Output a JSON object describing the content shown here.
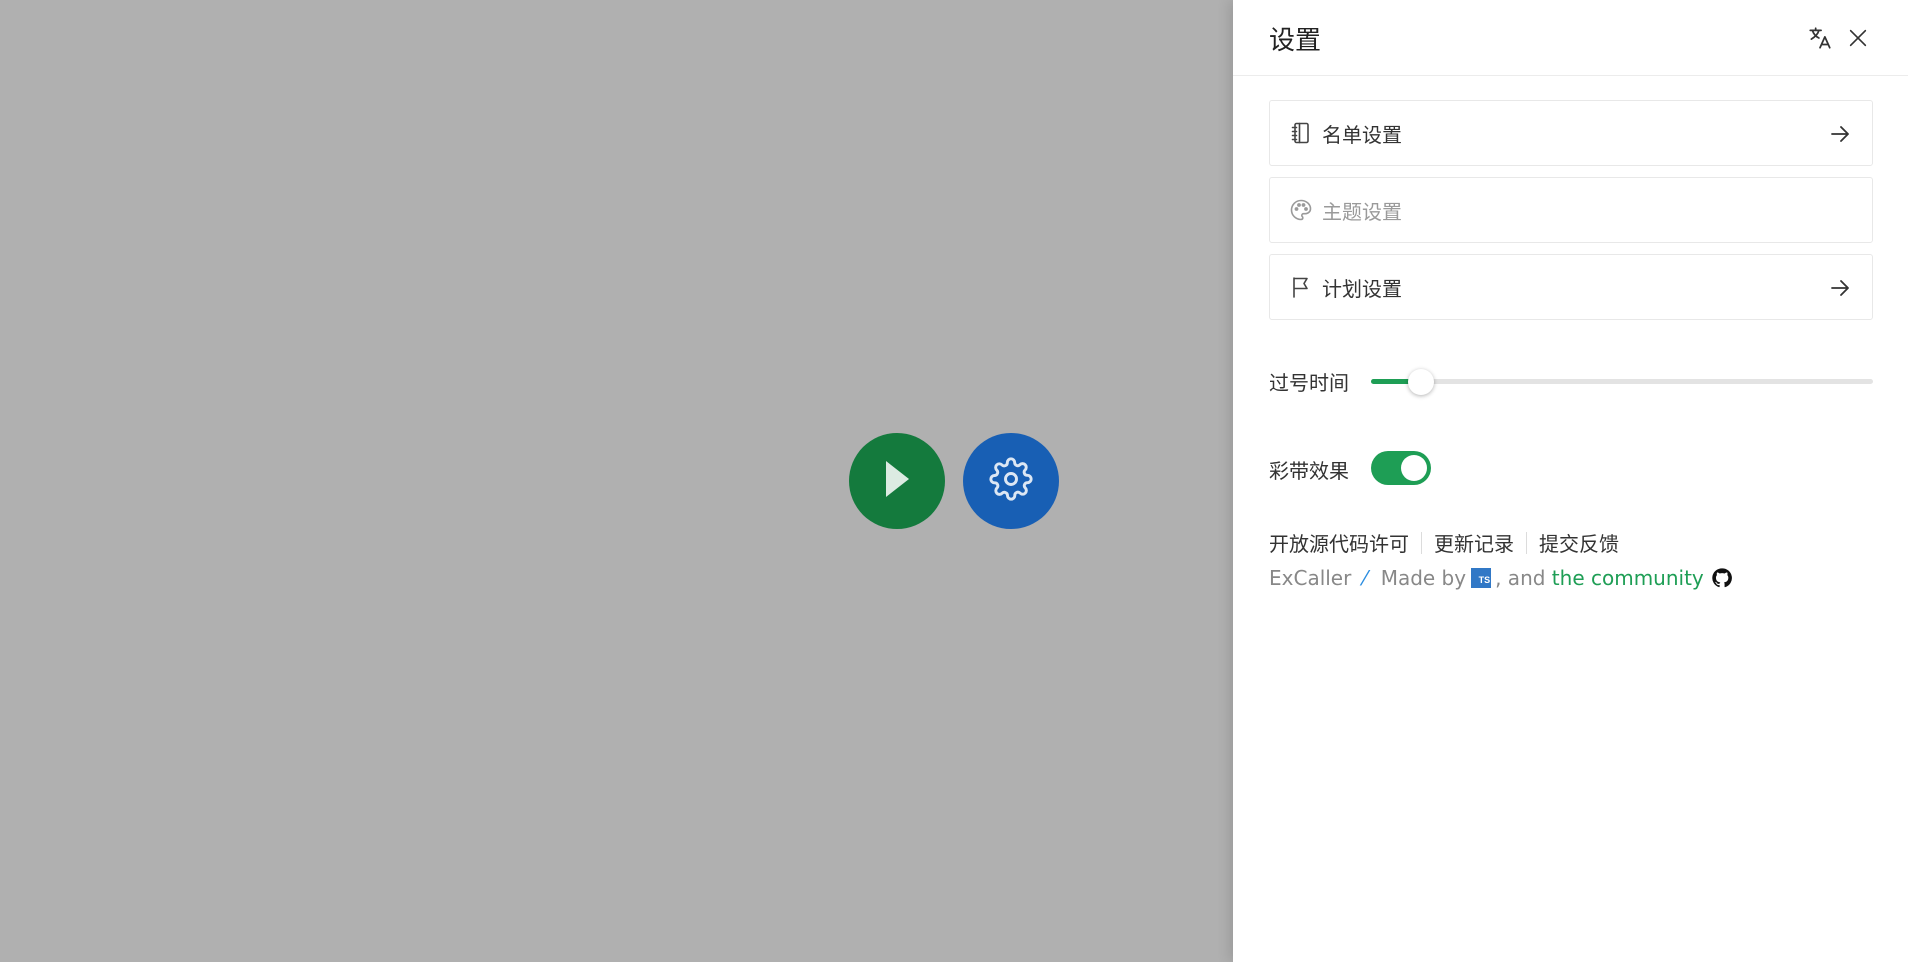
{
  "drawer": {
    "title": "设置"
  },
  "menu": [
    {
      "label": "名单设置",
      "icon": "notebook-icon",
      "has_arrow": true,
      "disabled": false
    },
    {
      "label": "主题设置",
      "icon": "palette-icon",
      "has_arrow": false,
      "disabled": true
    },
    {
      "label": "计划设置",
      "icon": "flag-icon",
      "has_arrow": true,
      "disabled": false
    }
  ],
  "slider": {
    "label": "过号时间",
    "value_fraction": 0.1
  },
  "toggle": {
    "label": "彩带效果",
    "on": true
  },
  "links": [
    "开放源代码许可",
    "更新记录",
    "提交反馈"
  ],
  "credits": {
    "app": "ExCaller",
    "made_by": "Made by",
    "ts_badge": "TS",
    "and": ", and",
    "community": "the community"
  },
  "colors": {
    "accent_green": "#1e9e55",
    "play_button": "#147a3d",
    "settings_button": "#185fb4",
    "backdrop": "#b0b0b0"
  }
}
